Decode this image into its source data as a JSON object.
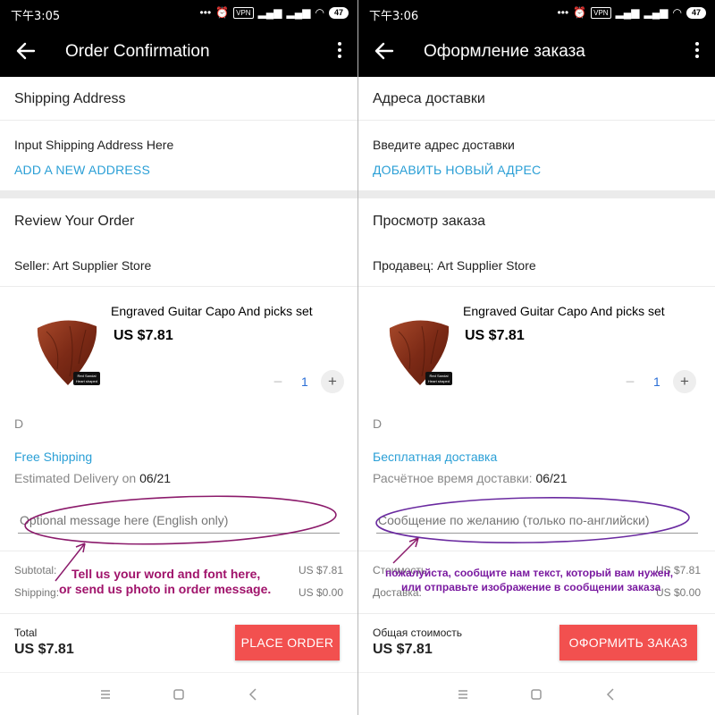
{
  "left": {
    "status": {
      "time": "下午3:05",
      "battery": "47",
      "vpn": "VPN"
    },
    "appbar": {
      "title": "Order Confirmation"
    },
    "shipping": {
      "heading": "Shipping Address",
      "prompt": "Input Shipping Address Here",
      "add_link": "ADD A NEW ADDRESS"
    },
    "review": {
      "heading": "Review Your Order",
      "seller": "Seller: Art Supplier Store"
    },
    "product": {
      "name": "Engraved Guitar Capo And picks set",
      "price": "US $7.81",
      "quantity": "1",
      "variant": "D",
      "tag_line1": "Red Sandal",
      "tag_line2": "Heart shaped"
    },
    "delivery": {
      "method": "Free Shipping",
      "estimate_label": "Estimated Delivery on",
      "estimate_date": "06/21"
    },
    "message": {
      "placeholder": "Optional message here (English only)"
    },
    "summary": {
      "subtotal_label": "Subtotal:",
      "subtotal_value": "US $7.81",
      "shipping_label": "Shipping:",
      "shipping_value": "US $0.00"
    },
    "footer": {
      "total_label": "Total",
      "total_value": "US $7.81",
      "button": "PLACE ORDER"
    },
    "annotation": {
      "line1": "Tell us your word and font here,",
      "line2": "or send us photo in order message."
    }
  },
  "right": {
    "status": {
      "time": "下午3:06",
      "battery": "47",
      "vpn": "VPN"
    },
    "appbar": {
      "title": "Оформление заказа"
    },
    "shipping": {
      "heading": "Адреса доставки",
      "prompt": "Введите адрес доставки",
      "add_link": "ДОБАВИТЬ НОВЫЙ АДРЕС"
    },
    "review": {
      "heading": "Просмотр заказа",
      "seller": "Продавец: Art Supplier Store"
    },
    "product": {
      "name": "Engraved Guitar Capo And picks set",
      "price": "US $7.81",
      "quantity": "1",
      "variant": "D",
      "tag_line1": "Red Sandal",
      "tag_line2": "Heart shaped"
    },
    "delivery": {
      "method": "Бесплатная доставка",
      "estimate_label": "Расчётное время доставки:",
      "estimate_date": "06/21"
    },
    "message": {
      "placeholder": "Сообщение по желанию (только по-английски)"
    },
    "summary": {
      "subtotal_label": "Стоимость",
      "subtotal_value": "US $7.81",
      "shipping_label": "Доставка:",
      "shipping_value": "US $0.00"
    },
    "footer": {
      "total_label": "Общая стоимость",
      "total_value": "US $7.81",
      "button": "ОФОРМИТЬ ЗАКАЗ"
    },
    "annotation": {
      "line1": "пожалуйста, сообщите нам текст, который вам нужен,",
      "line2": "или отправьте изображение в сообщении заказа"
    }
  },
  "colors": {
    "accent": "#2a9fd6",
    "button": "#f2504f",
    "annotation": "#a0136b",
    "annotation_right": "#7a1aa0",
    "ellipse_left": "#8b1a6b",
    "ellipse_right": "#6a2aa0"
  }
}
